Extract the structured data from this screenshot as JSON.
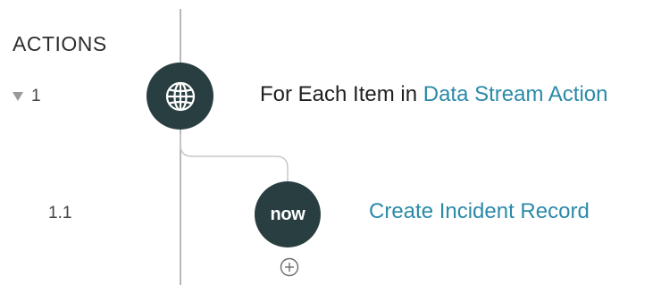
{
  "section": {
    "title": "ACTIONS"
  },
  "rows": [
    {
      "index": "1",
      "label_prefix": "For Each Item in ",
      "label_link": "Data Stream Action",
      "icon": "globe-icon"
    },
    {
      "index": "1.1",
      "label_link": "Create Incident Record",
      "icon": "now-logo",
      "icon_text": "now"
    }
  ],
  "colors": {
    "node_bg": "#293e40",
    "link": "#2b8aa8",
    "line": "#b9b9b9"
  },
  "add_button": {
    "icon": "plus-circle-icon"
  }
}
